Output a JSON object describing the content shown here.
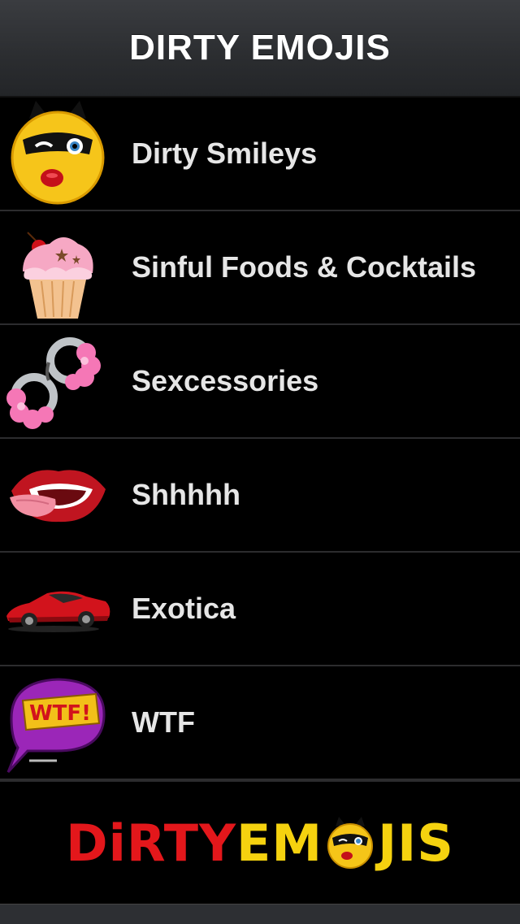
{
  "header": {
    "title": "DIRTY EMOJIS"
  },
  "categories": [
    {
      "label": "Dirty Smileys",
      "icon": "winking-smiley-icon"
    },
    {
      "label": "Sinful Foods & Cocktails",
      "icon": "cupcake-icon"
    },
    {
      "label": "Sexcessories",
      "icon": "furry-handcuffs-icon"
    },
    {
      "label": "Shhhhh",
      "icon": "lips-tongue-icon"
    },
    {
      "label": "Exotica",
      "icon": "sports-car-icon"
    },
    {
      "label": "WTF",
      "icon": "wtf-speech-bubble-icon"
    }
  ],
  "footer": {
    "logo_part1": "DiRTY",
    "logo_part2": "EM",
    "logo_part3": "JIS"
  },
  "colors": {
    "logo_red": "#e3171b",
    "logo_yellow": "#f5d20f",
    "label_text": "#e6e6e6"
  }
}
